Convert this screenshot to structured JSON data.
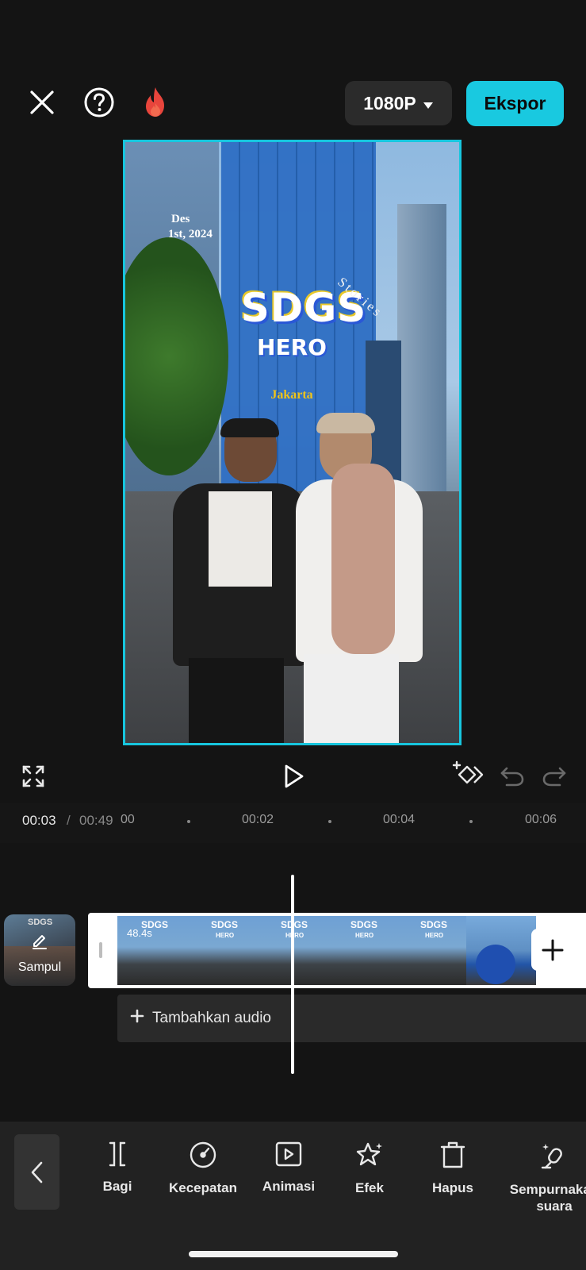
{
  "header": {
    "resolution": "1080P",
    "export_label": "Ekspor"
  },
  "preview": {
    "date_line1": "Des",
    "date_line2": "1st, 2024",
    "title": "SDGS",
    "subtitle": "HERO",
    "stories": "Stories",
    "location": "Jakarta"
  },
  "playback": {
    "current_time": "00:03",
    "separator": "/",
    "total_time": "00:49",
    "ruler": [
      "00",
      "00:02",
      "00:04",
      "00:06"
    ]
  },
  "timeline": {
    "cover_label": "Sampul",
    "clip_duration": "48.4s",
    "frame_title": "SDGS",
    "frame_subtitle": "HERO",
    "add_audio_label": "Tambahkan audio"
  },
  "toolbar": {
    "items": [
      {
        "label": "Bagi",
        "icon": "split-icon"
      },
      {
        "label": "Kecepatan",
        "icon": "speed-icon"
      },
      {
        "label": "Animasi",
        "icon": "animation-icon"
      },
      {
        "label": "Efek",
        "icon": "effects-icon"
      },
      {
        "label": "Hapus",
        "icon": "delete-icon"
      },
      {
        "label": "Sempurnakan suara",
        "icon": "enhance-voice-icon"
      }
    ]
  },
  "colors": {
    "accent": "#19c9e0",
    "background": "#141414",
    "toolbar_bg": "#222222",
    "fire": "#e8453c"
  }
}
